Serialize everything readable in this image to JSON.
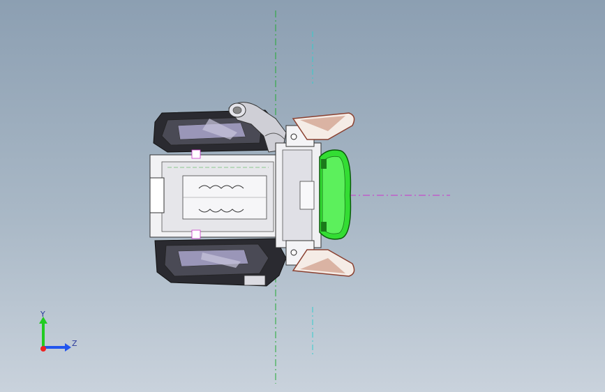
{
  "viewport": {
    "background_top": "#8c9fb2",
    "background_bottom": "#c9d2dc"
  },
  "model": {
    "highlight_color": "#33dd33",
    "body_color": "#2a2a30",
    "accent_color": "#8a4030"
  },
  "triad": {
    "y_label": "Y",
    "z_label": "Z",
    "y_color": "#22cc22",
    "z_color": "#2255ee",
    "x_color": "#ee2222"
  }
}
